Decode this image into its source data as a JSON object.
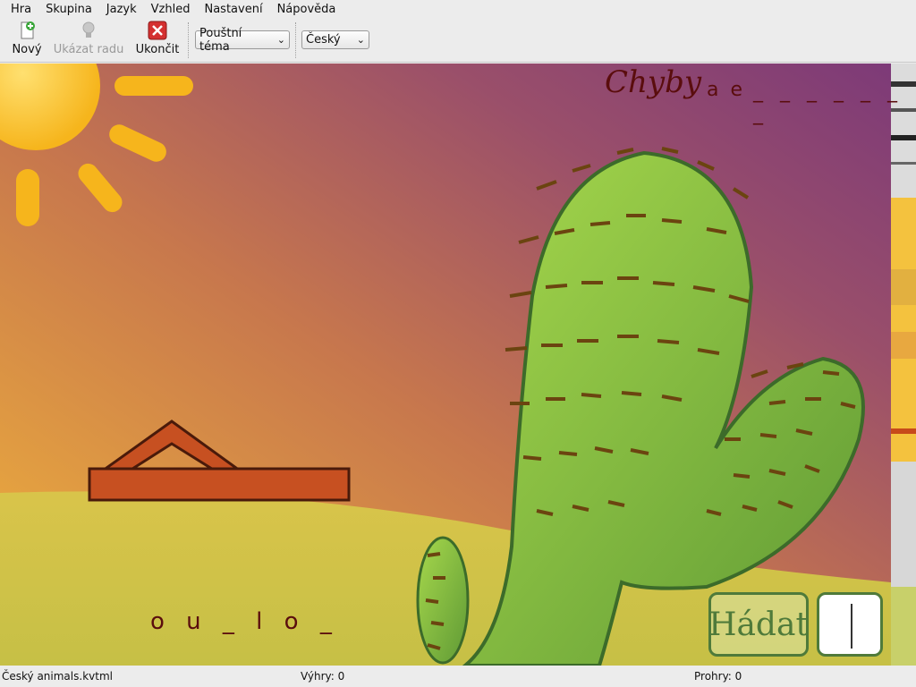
{
  "menu": [
    {
      "label": "Hra"
    },
    {
      "label": "Skupina"
    },
    {
      "label": "Jazyk"
    },
    {
      "label": "Vzhled"
    },
    {
      "label": "Nastavení"
    },
    {
      "label": "Nápověda"
    }
  ],
  "toolbar": {
    "new_label": "Nový",
    "hint_label": "Ukázat radu",
    "quit_label": "Ukončit",
    "theme_value": "Pouštní téma",
    "language_value": "Český"
  },
  "game": {
    "misses_title": "Chyby",
    "missed_letters": "a e",
    "misses_blanks": "_ _ _ _ _ _ _",
    "word": "o u _ l o _",
    "guess_label": "Hádat",
    "guess_value": ""
  },
  "status": {
    "file": "Český animals.kvtml",
    "wins": "Výhry: 0",
    "losses": "Prohry: 0"
  },
  "colors": {
    "text_dark_red": "#5a0d0d",
    "button_green": "#4f7a3a",
    "sky_top": "#7d3a78",
    "sand": "#d9c44a"
  },
  "icons": {
    "new": "new-document-icon",
    "hint": "lightbulb-icon",
    "quit": "close-icon"
  }
}
